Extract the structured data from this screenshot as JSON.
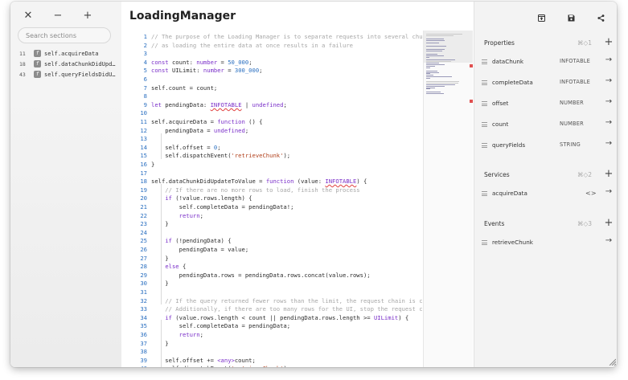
{
  "sidebar": {
    "toolbar": {
      "close": "✕",
      "collapse": "−",
      "expand": "+"
    },
    "search_placeholder": "Search sections",
    "items": [
      {
        "line": "11",
        "label": "self.acquireData"
      },
      {
        "line": "18",
        "label": "self.dataChunkDidUpdateToValue"
      },
      {
        "line": "43",
        "label": "self.queryFieldsDidUpdateToValue"
      }
    ]
  },
  "editor": {
    "title": "LoadingManager",
    "line_numbers": [
      "1",
      "2",
      "3",
      "4",
      "5",
      "6",
      "7",
      "8",
      "9",
      "10",
      "11",
      "12",
      "13",
      "14",
      "15",
      "16",
      "17",
      "18",
      "19",
      "20",
      "21",
      "22",
      "23",
      "24",
      "25",
      "26",
      "27",
      "28",
      "29",
      "30",
      "31",
      "32",
      "33",
      "34",
      "35",
      "36",
      "37",
      "38",
      "39",
      "40"
    ]
  },
  "properties": {
    "title": "Properties",
    "shortcut": "⌘◇1",
    "items": [
      {
        "name": "dataChunk",
        "type": "INFOTABLE"
      },
      {
        "name": "completeData",
        "type": "INFOTABLE"
      },
      {
        "name": "offset",
        "type": "NUMBER"
      },
      {
        "name": "count",
        "type": "NUMBER"
      },
      {
        "name": "queryFields",
        "type": "STRING"
      }
    ]
  },
  "services": {
    "title": "Services",
    "shortcut": "⌘◇2",
    "items": [
      {
        "name": "acquireData",
        "type": "<>"
      }
    ]
  },
  "events": {
    "title": "Events",
    "shortcut": "⌘◇3",
    "items": [
      {
        "name": "retrieveChunk",
        "type": ""
      }
    ]
  },
  "icons": {
    "add": "+",
    "arrow": "→",
    "toolbar": [
      "window-icon",
      "save-icon",
      "share-icon"
    ]
  }
}
